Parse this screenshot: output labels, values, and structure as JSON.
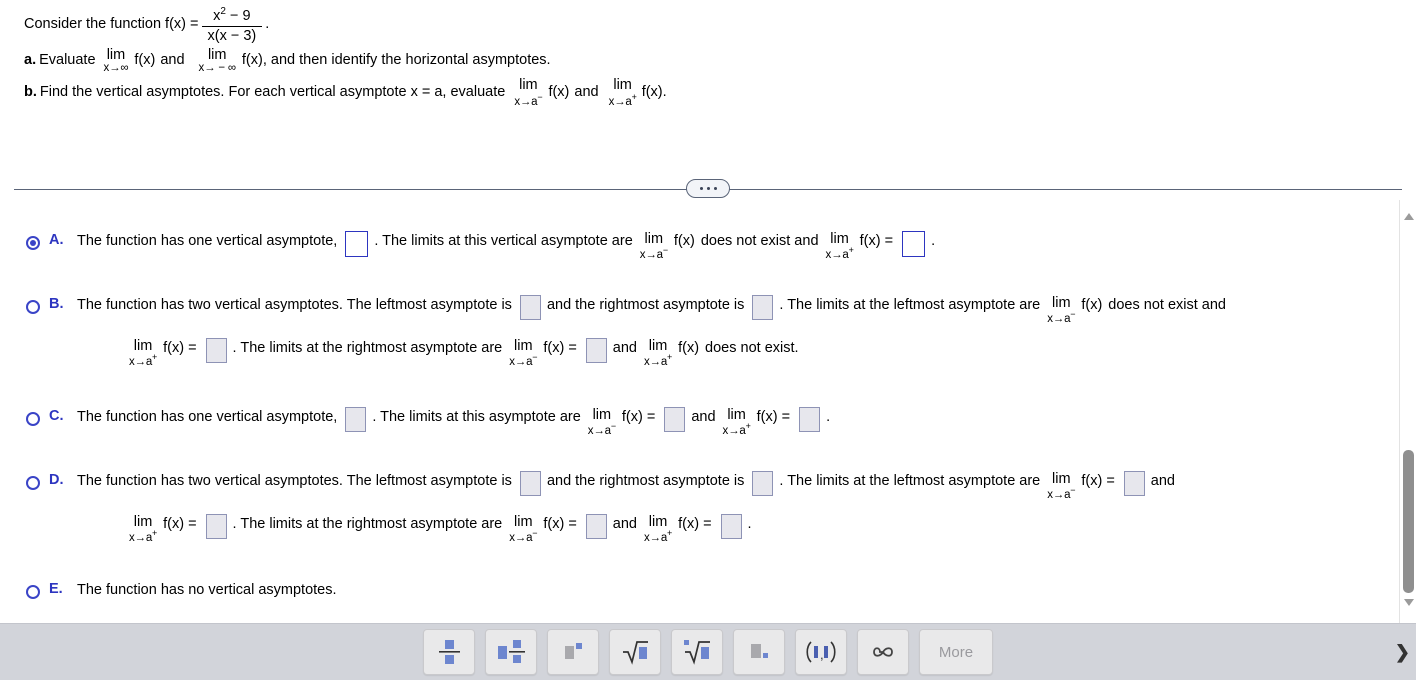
{
  "problem": {
    "intro": "Consider the function f(x) =",
    "fraction": {
      "numerator": "x2 − 9",
      "numerator_base": "x",
      "numerator_exp": "2",
      "numerator_rest": "− 9",
      "denominator": "x(x − 3)"
    },
    "period": ".",
    "part_a": {
      "label": "a.",
      "text_1": "Evaluate",
      "lim1": {
        "op": "lim",
        "sub": "x→∞",
        "expr": "f(x)"
      },
      "text_2": "and",
      "lim2": {
        "op": "lim",
        "sub": "x→ − ∞",
        "expr": "f(x)"
      },
      "text_3": ", and then identify the horizontal asymptotes."
    },
    "part_b": {
      "label": "b.",
      "text_1": "Find the vertical asymptotes. For each vertical asymptote x = a, evaluate",
      "lim1": {
        "op": "lim",
        "sub": "x→a",
        "sup": "−",
        "expr": "f(x)"
      },
      "text_2": "and",
      "lim2": {
        "op": "lim",
        "sub": "x→a",
        "sup": "+",
        "expr": "f(x)"
      },
      "text_3": "."
    }
  },
  "divider": {
    "ellipsis_label": "•••"
  },
  "options": [
    {
      "letter": "A.",
      "selected": true,
      "rows": [
        [
          {
            "type": "text",
            "value": "The function has one vertical asymptote,"
          },
          {
            "type": "box",
            "state": "active"
          },
          {
            "type": "text",
            "value": ". The limits at this vertical asymptote are"
          },
          {
            "type": "lim",
            "op": "lim",
            "sub": "x→a",
            "sup": "−",
            "expr": "f(x)"
          },
          {
            "type": "text",
            "value": "does not exist and"
          },
          {
            "type": "lim",
            "op": "lim",
            "sub": "x→a",
            "sup": "+",
            "expr": "f(x) ="
          },
          {
            "type": "box",
            "state": "active"
          },
          {
            "type": "text",
            "value": "."
          }
        ]
      ]
    },
    {
      "letter": "B.",
      "selected": false,
      "rows": [
        [
          {
            "type": "text",
            "value": "The function has two vertical asymptotes. The leftmost asymptote is"
          },
          {
            "type": "box",
            "state": "disabled"
          },
          {
            "type": "text",
            "value": "and the rightmost asymptote is"
          },
          {
            "type": "box",
            "state": "disabled"
          },
          {
            "type": "text",
            "value": ". The limits at the leftmost asymptote are"
          },
          {
            "type": "lim",
            "op": "lim",
            "sub": "x→a",
            "sup": "−",
            "expr": "f(x)"
          },
          {
            "type": "text",
            "value": "does not exist and"
          }
        ],
        [
          {
            "type": "lim",
            "op": "lim",
            "sub": "x→a",
            "sup": "+",
            "expr": "f(x) ="
          },
          {
            "type": "box",
            "state": "disabled"
          },
          {
            "type": "text",
            "value": ". The limits at the rightmost asymptote are"
          },
          {
            "type": "lim",
            "op": "lim",
            "sub": "x→a",
            "sup": "−",
            "expr": "f(x) ="
          },
          {
            "type": "box",
            "state": "disabled"
          },
          {
            "type": "text",
            "value": "and"
          },
          {
            "type": "lim",
            "op": "lim",
            "sub": "x→a",
            "sup": "+",
            "expr": "f(x)"
          },
          {
            "type": "text",
            "value": "does not exist."
          }
        ]
      ]
    },
    {
      "letter": "C.",
      "selected": false,
      "rows": [
        [
          {
            "type": "text",
            "value": "The function has one vertical asymptote,"
          },
          {
            "type": "box",
            "state": "disabled"
          },
          {
            "type": "text",
            "value": ". The limits at this asymptote are"
          },
          {
            "type": "lim",
            "op": "lim",
            "sub": "x→a",
            "sup": "−",
            "expr": "f(x) ="
          },
          {
            "type": "box",
            "state": "disabled"
          },
          {
            "type": "text",
            "value": "and"
          },
          {
            "type": "lim",
            "op": "lim",
            "sub": "x→a",
            "sup": "+",
            "expr": "f(x) ="
          },
          {
            "type": "box",
            "state": "disabled"
          },
          {
            "type": "text",
            "value": "."
          }
        ]
      ]
    },
    {
      "letter": "D.",
      "selected": false,
      "rows": [
        [
          {
            "type": "text",
            "value": "The function has two vertical asymptotes. The leftmost asymptote is"
          },
          {
            "type": "box",
            "state": "disabled"
          },
          {
            "type": "text",
            "value": "and the rightmost asymptote is"
          },
          {
            "type": "box",
            "state": "disabled"
          },
          {
            "type": "text",
            "value": ". The limits at the leftmost asymptote are"
          },
          {
            "type": "lim",
            "op": "lim",
            "sub": "x→a",
            "sup": "−",
            "expr": "f(x) ="
          },
          {
            "type": "box",
            "state": "disabled"
          },
          {
            "type": "text",
            "value": "and"
          }
        ],
        [
          {
            "type": "lim",
            "op": "lim",
            "sub": "x→a",
            "sup": "+",
            "expr": "f(x) ="
          },
          {
            "type": "box",
            "state": "disabled"
          },
          {
            "type": "text",
            "value": ". The limits at the rightmost asymptote are"
          },
          {
            "type": "lim",
            "op": "lim",
            "sub": "x→a",
            "sup": "−",
            "expr": "f(x) ="
          },
          {
            "type": "box",
            "state": "disabled"
          },
          {
            "type": "text",
            "value": "and"
          },
          {
            "type": "lim",
            "op": "lim",
            "sub": "x→a",
            "sup": "+",
            "expr": "f(x) ="
          },
          {
            "type": "box",
            "state": "disabled"
          },
          {
            "type": "text",
            "value": "."
          }
        ]
      ]
    },
    {
      "letter": "E.",
      "selected": false,
      "rows": [
        [
          {
            "type": "text",
            "value": "The function has no vertical asymptotes."
          }
        ]
      ]
    }
  ],
  "toolbar": {
    "buttons": [
      {
        "icon": "fraction-icon",
        "label": ""
      },
      {
        "icon": "mixed-number-icon",
        "label": ""
      },
      {
        "icon": "exponent-icon",
        "label": ""
      },
      {
        "icon": "square-root-icon",
        "label": ""
      },
      {
        "icon": "nth-root-icon",
        "label": ""
      },
      {
        "icon": "subscript-icon",
        "label": ""
      },
      {
        "icon": "interval-notation-icon",
        "label": "(▮,▮)"
      },
      {
        "icon": "infinity-icon",
        "label": "∞"
      },
      {
        "icon": "more-icon",
        "label": "More"
      }
    ],
    "expand_chevron": "❯"
  },
  "scrollbar": {
    "up_arrow": "scroll-up-arrow",
    "down_arrow": "scroll-down-arrow"
  },
  "colors": {
    "accent_blue": "#2d35c0",
    "toolbar_bg": "#d2d4da",
    "button_bg": "#e9e9ea",
    "disabled_box": "#e7e7ed",
    "icon_blue": "#6d86cf",
    "icon_gray": "#a9a9ad"
  }
}
